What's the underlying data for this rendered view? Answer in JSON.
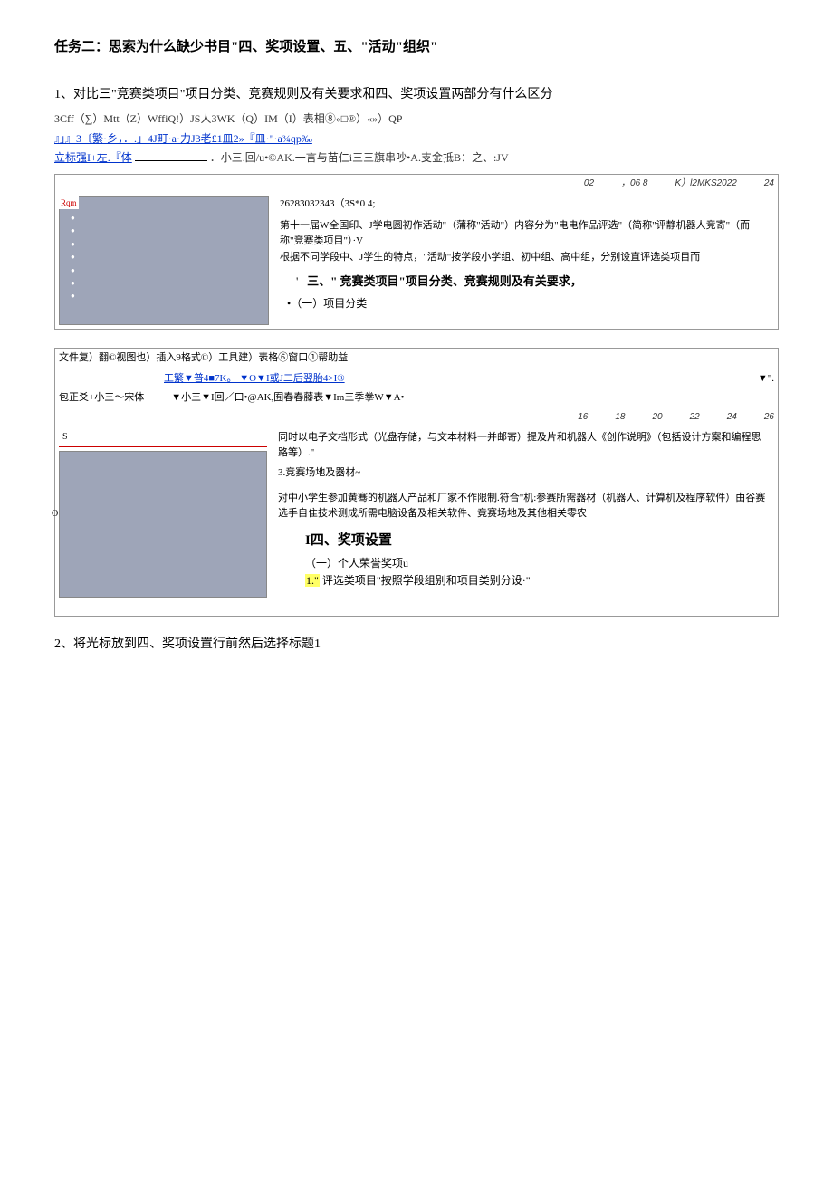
{
  "title": "任务二：思索为什么缺少书目\"四、奖项设置、五、\"活动\"组织\"",
  "para1": "1、对比三\"竞赛类项目\"项目分类、竞赛规则及有关要求和四、奖项设置两部分有什么区分",
  "garbled1": "3Cff（∑）Mtt（Z）WffiQ!）JS人3WK（Q）IM（I）表相⑧«□®）«»）QP",
  "garbled2": "』」』3〔繁·乡，．.」4J町·a·力J3老£1皿2»『皿·\"·a¾qp‰",
  "garbled3_left": "立标强I+左.『体",
  "garbled3_right": "．小三.回/u•©AK.一言与苗仁i三三旗串吵•A.支金抵B：之、:JV",
  "shot1": {
    "ruler": [
      "02",
      "，06   8",
      "K）l2MKS2022",
      "24"
    ],
    "label": "Rqm",
    "line1": "26283032343（3S*0                    4;",
    "line2": "第十一届W全国印、J学电圆初作活动\"（蒲称\"活动\"）内容分为\"电电作品评选\"（简称\"评静机器人竞寄\"（而称\"竞赛类项目\"）·V",
    "line3": "根据不同学段中、J学生的特点，\"活动\"按学段小学组、初中组、高中组，分别设直评选类项目而",
    "heading": "三、\" 竞赛类项目\"项目分类、竞赛规则及有关要求，",
    "sub": "•（一）项目分类"
  },
  "shot2": {
    "menubar": "文件复）翻©视图也）插入9格式©）工具建）表格⑥窗口①帮助益",
    "toolbar": "工繁▼普4■7K。 ▼O▼I或J二后翌胎4>I®",
    "toolbar_right": "▼\".",
    "styleline_left": "包正爻+小三～宋体",
    "styleline_right": "▼小三▼I回／口•@AK,囿春春藤表▼Im三季拳W▼A•",
    "ruler": [
      "16",
      "18",
      "20",
      "22",
      "24",
      "26"
    ],
    "body1": "同时以电子文档形式（光盘存储，与文本材料一并邮寄）提及片和机器人《创作说明》（包括设计方案和编程思路等）.\"",
    "body2": "3.竞赛场地及器材~",
    "body3": "对中小学生参加黄骞的机器人产品和厂家不作限制.符合\"机:参赛所需器材（机器人、计算机及程序软件）由谷赛选手自隹技术测成所需电脑设备及相关软件、竟赛场地及其他相关零农",
    "heading": "I四、奖项设置",
    "sub1": "（一）个人荣誉奖项u",
    "sub2_marker": "1.\"",
    "sub2_text": "评选类项目\"按照学段组别和项目类别分设·\""
  },
  "para2": "2、将光标放到四、奖项设置行前然后选择标题1"
}
